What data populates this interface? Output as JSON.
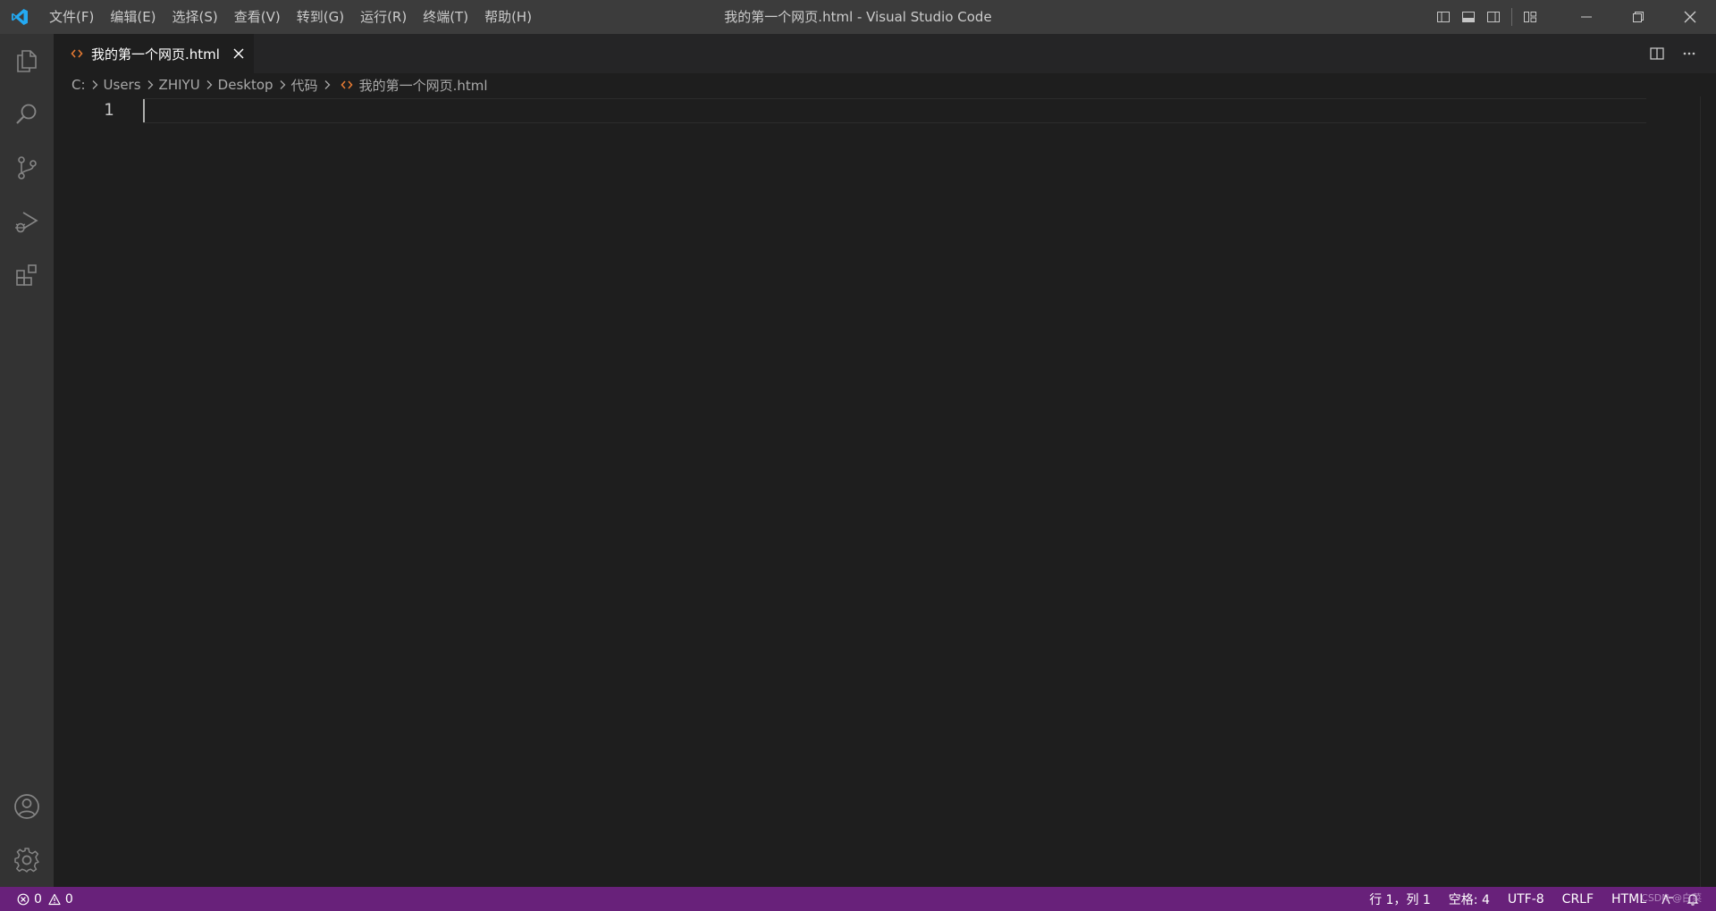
{
  "app": {
    "window_title": "我的第一个网页.html - Visual Studio Code"
  },
  "menu": {
    "items": [
      {
        "label": "文件(F)"
      },
      {
        "label": "编辑(E)"
      },
      {
        "label": "选择(S)"
      },
      {
        "label": "查看(V)"
      },
      {
        "label": "转到(G)"
      },
      {
        "label": "运行(R)"
      },
      {
        "label": "终端(T)"
      },
      {
        "label": "帮助(H)"
      }
    ]
  },
  "tab": {
    "label": "我的第一个网页.html"
  },
  "breadcrumb": {
    "items": [
      "C:",
      "Users",
      "ZHIYU",
      "Desktop",
      "代码",
      "我的第一个网页.html"
    ]
  },
  "editor": {
    "line_numbers": [
      "1"
    ]
  },
  "statusbar": {
    "errors": "0",
    "warnings": "0",
    "cursor_position": "行 1，列 1",
    "indent": "空格: 4",
    "encoding": "UTF-8",
    "eol": "CRLF",
    "language": "HTML",
    "watermark": "CSDN @白菜"
  },
  "colors": {
    "statusbar_bg": "#68217a",
    "vscode_blue": "#23a9f2",
    "html_icon": "#e37933"
  },
  "icons": {
    "activity": [
      "explorer-icon",
      "search-icon",
      "source-control-icon",
      "run-debug-icon",
      "extensions-icon",
      "account-icon",
      "manage-gear-icon"
    ]
  }
}
